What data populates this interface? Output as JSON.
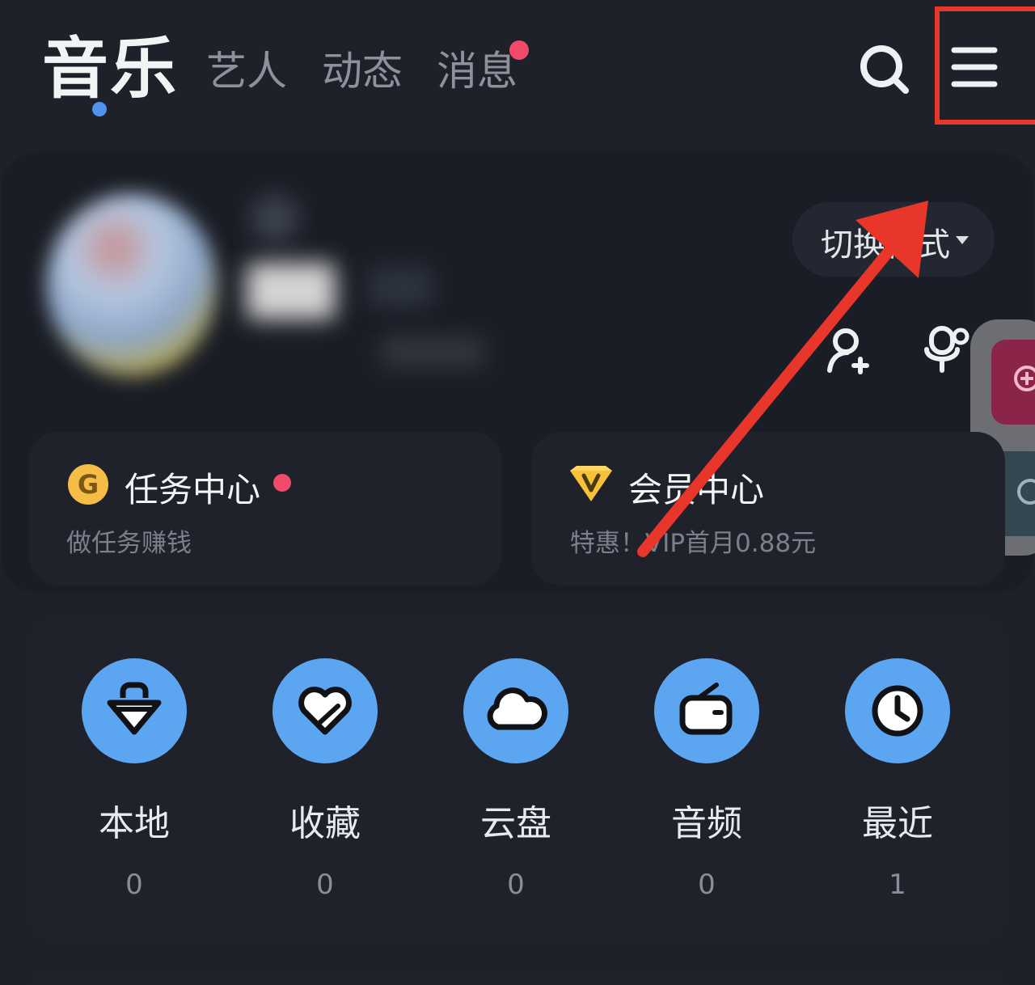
{
  "top_tabs": {
    "music": "音乐",
    "artist": "艺人",
    "feed": "动态",
    "messages": "消息"
  },
  "profile": {
    "switch_mode": "切换模式"
  },
  "task_center": {
    "title": "任务中心",
    "subtitle": "做任务赚钱",
    "icon_letter": "G"
  },
  "vip_center": {
    "title": "会员中心",
    "subtitle": "特惠！VIP首月0.88元"
  },
  "shortcuts": [
    {
      "label": "本地",
      "count": "0",
      "icon": "local-bag-icon"
    },
    {
      "label": "收藏",
      "count": "0",
      "icon": "heart-icon"
    },
    {
      "label": "云盘",
      "count": "0",
      "icon": "cloud-icon"
    },
    {
      "label": "音频",
      "count": "0",
      "icon": "radio-icon"
    },
    {
      "label": "最近",
      "count": "1",
      "icon": "clock-icon"
    }
  ],
  "colors": {
    "background": "#1e212a",
    "accent_blue": "#5ca5f0",
    "notification_red": "#f24a6a",
    "annotation_red": "#e8362b"
  }
}
